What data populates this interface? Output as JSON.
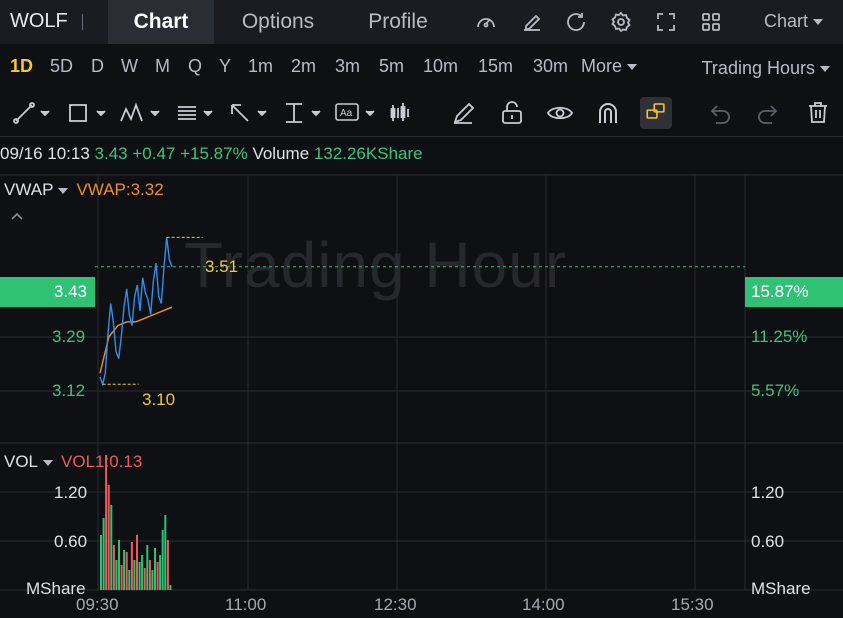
{
  "header": {
    "ticker": "WOLF",
    "tabs": [
      {
        "label": "Chart",
        "active": true
      },
      {
        "label": "Options",
        "active": false
      },
      {
        "label": "Profile",
        "active": false
      }
    ],
    "icons": [
      "gauge-icon",
      "edit-icon",
      "refresh-icon",
      "settings-icon",
      "fullscreen-icon",
      "grid-icon"
    ],
    "chart_type_label": "Chart"
  },
  "periods": {
    "items": [
      "1D",
      "5D",
      "D",
      "W",
      "M",
      "Q",
      "Y",
      "1m",
      "2m",
      "3m",
      "5m",
      "10m",
      "15m",
      "30m"
    ],
    "active": "1D",
    "more_label": "More",
    "trading_hours_label": "Trading Hours"
  },
  "toolbar": {
    "tools": [
      "trendline-tool-icon",
      "rectangle-tool-icon",
      "pattern-tool-icon",
      "fib-tool-icon",
      "arrow-tool-icon",
      "measure-tool-icon",
      "text-tool-icon",
      "indicator-tool-icon",
      "pencil-icon",
      "unlock-icon",
      "eye-icon",
      "magnet-icon",
      "lock-layer-icon",
      "undo-icon",
      "redo-icon",
      "trash-icon"
    ]
  },
  "quote": {
    "time": "09/16 10:13",
    "price": "3.43",
    "change": "+0.47",
    "change_pct": "+15.87%",
    "volume_label": "Volume",
    "volume": "132.26KShare"
  },
  "main_pane": {
    "indicator": "VWAP",
    "indicator_value": "VWAP:3.32",
    "watermark": "Trading Hour",
    "current_price": "3.43",
    "current_pct": "15.87%",
    "left_ticks": [
      "3.29",
      "3.12"
    ],
    "right_ticks": [
      "11.25%",
      "5.57%"
    ],
    "high_label": "3.51",
    "low_label": "3.10",
    "colors": {
      "price_line": "#2f8fea",
      "vwap_line": "#ef8f2a",
      "up": "#2fc275",
      "down": "#ec5b5b",
      "marker": "#f4c82e"
    }
  },
  "volume_pane": {
    "indicator": "VOL",
    "indicator_value": "VOL1:0.13",
    "left_ticks": [
      "1.20",
      "0.60"
    ],
    "unit": "MShare",
    "right_ticks": [
      "1.20",
      "0.60"
    ]
  },
  "x_axis": [
    "09:30",
    "11:00",
    "12:30",
    "14:00",
    "15:30"
  ],
  "chart_data": {
    "type": "line",
    "x_range": [
      "09:30",
      "16:00"
    ],
    "series": [
      {
        "name": "VWAP",
        "values": [
          3.14,
          3.24,
          3.27,
          3.28,
          3.28,
          3.29,
          3.3,
          3.31,
          3.32
        ]
      }
    ],
    "price": [
      3.13,
      3.11,
      3.14,
      3.25,
      3.33,
      3.28,
      3.2,
      3.18,
      3.24,
      3.32,
      3.37,
      3.3,
      3.27,
      3.35,
      3.38,
      3.31,
      3.4,
      3.36,
      3.34,
      3.3,
      3.39,
      3.44,
      3.35,
      3.33,
      3.43,
      3.51,
      3.45,
      3.43
    ],
    "price_ylim": [
      2.95,
      3.68
    ],
    "volume": [
      0.55,
      0.72,
      1.35,
      1.05,
      0.85,
      0.45,
      0.3,
      0.5,
      0.25,
      0.4,
      0.38,
      0.2,
      0.48,
      0.3,
      0.55,
      0.28,
      0.35,
      0.22,
      0.45,
      0.3,
      0.2,
      0.42,
      0.28,
      0.35,
      0.6,
      0.75,
      0.5,
      0.05
    ],
    "volume_up": [
      true,
      true,
      false,
      false,
      true,
      false,
      true,
      true,
      false,
      true,
      false,
      true,
      false,
      true,
      false,
      true,
      true,
      false,
      true,
      false,
      true,
      true,
      false,
      true,
      true,
      true,
      false,
      true
    ],
    "volume_ylim": [
      0,
      1.45
    ]
  }
}
